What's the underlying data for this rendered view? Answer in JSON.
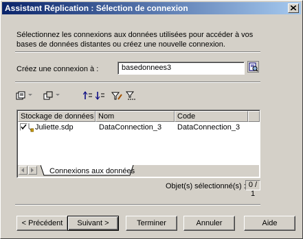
{
  "window": {
    "title": "Assistant Réplication : Sélection de connexion"
  },
  "description": {
    "line1": "Sélectionnez les connexions aux données utilisées pour accéder à vos",
    "line2": "bases de données distantes ou créez une nouvelle connexion."
  },
  "connection": {
    "label": "Créez une connexion à :",
    "value": "basedonnees3"
  },
  "toolbar": {
    "icons": [
      "properties-icon",
      "dropdown-icon",
      "copy-icon",
      "dropdown-icon",
      "move-up-icon",
      "move-down-icon",
      "filter-icon",
      "find-icon"
    ]
  },
  "grid": {
    "columns": [
      "Stockage de données",
      "Nom",
      "Code"
    ],
    "rows": [
      {
        "checked": true,
        "storage": "Juliette.sdp",
        "name": "DataConnection_3",
        "code": "DataConnection_3"
      }
    ],
    "tab_label": "Connexions aux données"
  },
  "selection": {
    "label": "Objet(s) sélectionné(s) :",
    "value": "0 / 1"
  },
  "buttons": {
    "previous": "Précédent",
    "next": "Suivant",
    "finish": "Terminer",
    "cancel": "Annuler",
    "help": "Aide"
  },
  "colors": {
    "title_start": "#0a246a",
    "title_end": "#a6caf0",
    "face": "#d4d0c8"
  }
}
